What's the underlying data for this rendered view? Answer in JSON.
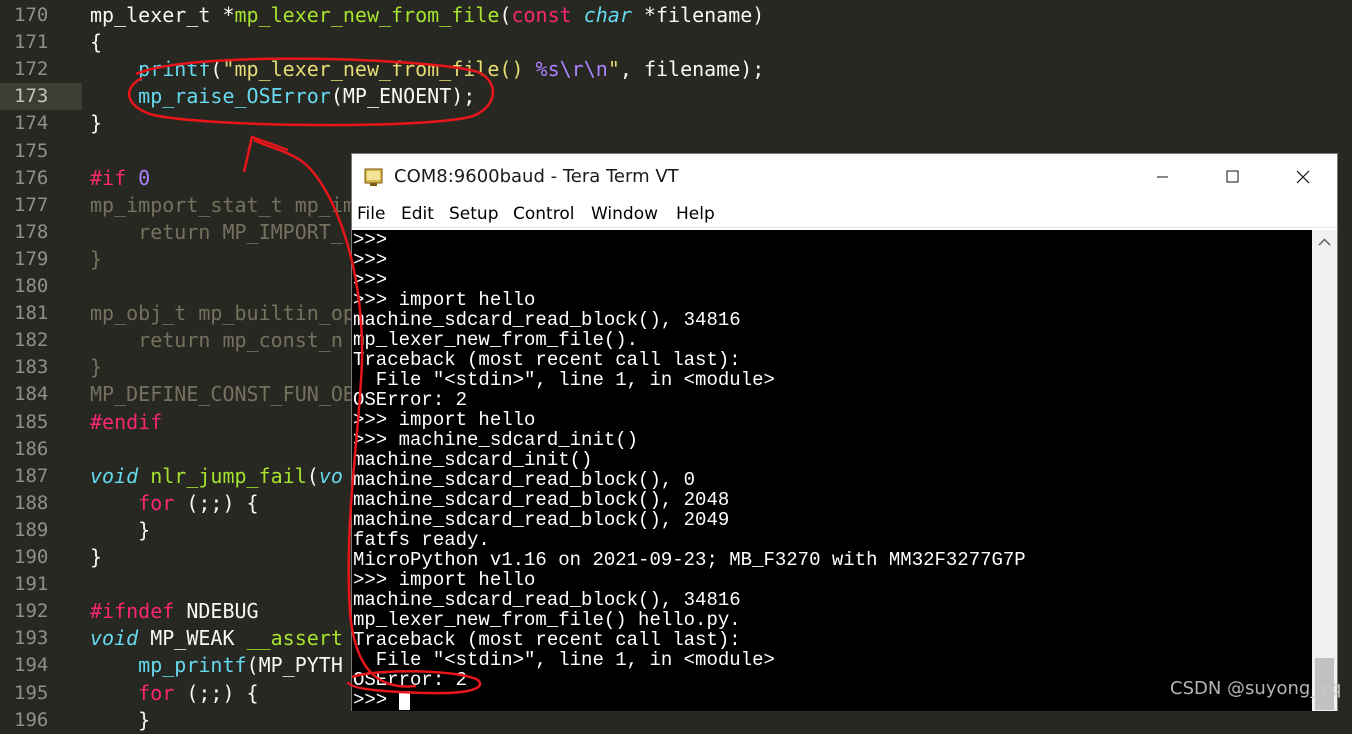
{
  "editor": {
    "colors": {
      "background": "#272822",
      "plain": "#f8f8f2",
      "keyword": "#f92672",
      "function": "#a6e22e",
      "type_italic": "#66d9ef",
      "string": "#e6db74",
      "number": "#ae81ff",
      "dimmed": "#75715e"
    },
    "lines": [
      {
        "num": "170",
        "tokens": [
          [
            "mp_lexer_t *",
            "plain"
          ],
          [
            "mp_lexer_new_from_file",
            "function"
          ],
          [
            "(",
            "plain"
          ],
          [
            "const",
            "keyword"
          ],
          [
            " ",
            "plain"
          ],
          [
            "char",
            "type_italic"
          ],
          [
            " *filename)",
            "plain"
          ]
        ]
      },
      {
        "num": "171",
        "tokens": [
          [
            "{",
            "plain"
          ]
        ]
      },
      {
        "num": "172",
        "tokens": [
          [
            "    ",
            "plain"
          ],
          [
            "printf",
            "type"
          ],
          [
            "(",
            "plain"
          ],
          [
            "\"mp_lexer_new_from_file() ",
            "string"
          ],
          [
            "%s",
            "number"
          ],
          [
            "\\r\\n",
            "number"
          ],
          [
            "\"",
            "string"
          ],
          [
            ", filename);",
            "plain"
          ]
        ]
      },
      {
        "num": "173",
        "current": true,
        "tokens": [
          [
            "    ",
            "plain"
          ],
          [
            "mp_raise_OSError",
            "type"
          ],
          [
            "(MP_ENOENT);",
            "plain"
          ]
        ]
      },
      {
        "num": "174",
        "tokens": [
          [
            "}",
            "plain"
          ]
        ]
      },
      {
        "num": "175",
        "tokens": []
      },
      {
        "num": "176",
        "tokens": [
          [
            "#if",
            "keyword"
          ],
          [
            " ",
            "plain"
          ],
          [
            "0",
            "number"
          ]
        ]
      },
      {
        "num": "177",
        "tokens": [
          [
            "mp_import_stat_t mp_im",
            "dimmed"
          ]
        ]
      },
      {
        "num": "178",
        "tokens": [
          [
            "    return MP_IMPORT_",
            "dimmed"
          ]
        ]
      },
      {
        "num": "179",
        "tokens": [
          [
            "}",
            "dimmed"
          ]
        ]
      },
      {
        "num": "180",
        "tokens": []
      },
      {
        "num": "181",
        "tokens": [
          [
            "mp_obj_t mp_builtin_op",
            "dimmed"
          ]
        ]
      },
      {
        "num": "182",
        "tokens": [
          [
            "    return mp_const_n",
            "dimmed"
          ]
        ]
      },
      {
        "num": "183",
        "tokens": [
          [
            "}",
            "dimmed"
          ]
        ]
      },
      {
        "num": "184",
        "tokens": [
          [
            "MP_DEFINE_CONST_FUN_OB",
            "dimmed"
          ]
        ]
      },
      {
        "num": "185",
        "tokens": [
          [
            "#endif",
            "keyword"
          ]
        ]
      },
      {
        "num": "186",
        "tokens": []
      },
      {
        "num": "187",
        "tokens": [
          [
            "void",
            "type_italic"
          ],
          [
            " ",
            "plain"
          ],
          [
            "nlr_jump_fail",
            "function"
          ],
          [
            "(",
            "plain"
          ],
          [
            "vo",
            "type_italic"
          ]
        ]
      },
      {
        "num": "188",
        "tokens": [
          [
            "    ",
            "plain"
          ],
          [
            "for",
            "keyword"
          ],
          [
            " (;;) {",
            "plain"
          ]
        ]
      },
      {
        "num": "189",
        "tokens": [
          [
            "    }",
            "plain"
          ]
        ]
      },
      {
        "num": "190",
        "tokens": [
          [
            "}",
            "plain"
          ]
        ]
      },
      {
        "num": "191",
        "tokens": []
      },
      {
        "num": "192",
        "tokens": [
          [
            "#ifndef",
            "keyword"
          ],
          [
            " NDEBUG",
            "plain"
          ]
        ]
      },
      {
        "num": "193",
        "tokens": [
          [
            "void",
            "type_italic"
          ],
          [
            " MP_WEAK ",
            "plain"
          ],
          [
            "__assert",
            "function"
          ]
        ]
      },
      {
        "num": "194",
        "tokens": [
          [
            "    ",
            "plain"
          ],
          [
            "mp_printf",
            "type"
          ],
          [
            "(MP_PYTH",
            "plain"
          ]
        ]
      },
      {
        "num": "195",
        "tokens": [
          [
            "    ",
            "plain"
          ],
          [
            "for",
            "keyword"
          ],
          [
            " (;;) {",
            "plain"
          ]
        ]
      },
      {
        "num": "196",
        "tokens": [
          [
            "    }",
            "plain"
          ]
        ]
      }
    ]
  },
  "teraterm": {
    "title": "COM8:9600baud - Tera Term VT",
    "menu": [
      "File",
      "Edit",
      "Setup",
      "Control",
      "Window",
      "Help"
    ],
    "terminal_lines": [
      ">>>",
      ">>>",
      ">>>",
      ">>> import hello",
      "machine_sdcard_read_block(), 34816",
      "mp_lexer_new_from_file().",
      "Traceback (most recent call last):",
      "  File \"<stdin>\", line 1, in <module>",
      "OSError: 2",
      ">>> import hello",
      ">>> machine_sdcard_init()",
      "machine_sdcard_init()",
      "machine_sdcard_read_block(), 0",
      "machine_sdcard_read_block(), 2048",
      "machine_sdcard_read_block(), 2049",
      "fatfs ready.",
      "MicroPython v1.16 on 2021-09-23; MB_F3270 with MM32F3277G7P",
      ">>> import hello",
      "machine_sdcard_read_block(), 34816",
      "mp_lexer_new_from_file() hello.py.",
      "Traceback (most recent call last):",
      "  File \"<stdin>\", line 1, in <module>",
      "OSError: 2",
      ">>> "
    ],
    "colors": {
      "terminal_bg": "#000000",
      "terminal_fg": "#ffffff"
    }
  },
  "annotation": {
    "color": "#e8161b"
  },
  "watermark": "CSDN @suyong_yq"
}
